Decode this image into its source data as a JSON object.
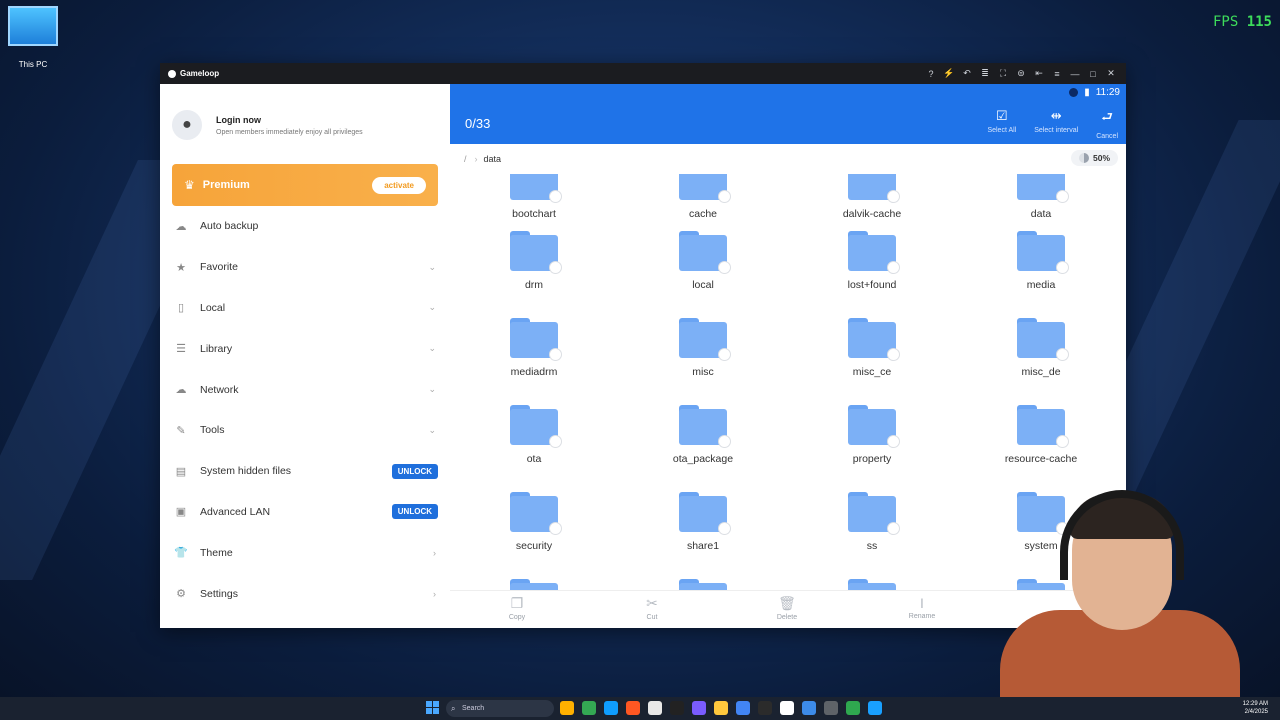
{
  "desktop": {
    "icon_label": "This PC",
    "fps_label": "FPS",
    "fps_value": "115"
  },
  "window": {
    "title": "Gameloop",
    "controls": [
      "?",
      "⚡",
      "↶",
      "≣",
      "⛶",
      "⊜",
      "⇤",
      "≡",
      "—",
      "□",
      "✕"
    ]
  },
  "sidebar": {
    "login_title": "Login now",
    "login_subtitle": "Open members immediately enjoy all privileges",
    "premium_label": "Premium",
    "activate_label": "activate",
    "items": [
      {
        "label": "Auto backup",
        "icon": "☁",
        "chevron": ""
      },
      {
        "label": "Favorite",
        "icon": "★",
        "chevron": "⌄"
      },
      {
        "label": "Local",
        "icon": "▯",
        "chevron": "⌄"
      },
      {
        "label": "Library",
        "icon": "☰",
        "chevron": "⌄"
      },
      {
        "label": "Network",
        "icon": "☁",
        "chevron": "⌄"
      },
      {
        "label": "Tools",
        "icon": "✎",
        "chevron": "⌄"
      },
      {
        "label": "System hidden files",
        "icon": "▤",
        "badge": "UNLOCK"
      },
      {
        "label": "Advanced LAN",
        "icon": "▣",
        "badge": "UNLOCK"
      },
      {
        "label": "Theme",
        "icon": "👕",
        "chevron": "›"
      },
      {
        "label": "Settings",
        "icon": "⚙",
        "chevron": "›"
      }
    ]
  },
  "main": {
    "status_time": "11:29",
    "selection_count": "0/33",
    "actions": [
      {
        "label": "Select All",
        "icon": "☑"
      },
      {
        "label": "Select interval",
        "icon": "⇹"
      },
      {
        "label": "Cancel",
        "icon": "⮐"
      }
    ],
    "path_root": "/",
    "path_current": "data",
    "storage_percent": "50%",
    "files": [
      "bootchart",
      "cache",
      "dalvik-cache",
      "data",
      "drm",
      "local",
      "lost+found",
      "media",
      "mediadrm",
      "misc",
      "misc_ce",
      "misc_de",
      "ota",
      "ota_package",
      "property",
      "resource-cache",
      "security",
      "share1",
      "ss",
      "system"
    ],
    "bottom_actions": [
      {
        "label": "Copy",
        "icon": "❐"
      },
      {
        "label": "Cut",
        "icon": "✂"
      },
      {
        "label": "Delete",
        "icon": "🗑"
      },
      {
        "label": "Rename",
        "icon": "I"
      }
    ]
  },
  "taskbar": {
    "search_label": "Search",
    "clock_time": "12:29 AM",
    "clock_date": "2/4/2025",
    "app_colors": [
      "#ffb000",
      "#34a853",
      "#0f9dff",
      "#ff5722",
      "#e8e8e8",
      "#222222",
      "#7a5cff",
      "#ffc83d",
      "#4285f4",
      "#2b2b2b",
      "#ffffff",
      "#3d8be8",
      "#5f6368",
      "#2fa84f",
      "#19a0ff"
    ]
  }
}
